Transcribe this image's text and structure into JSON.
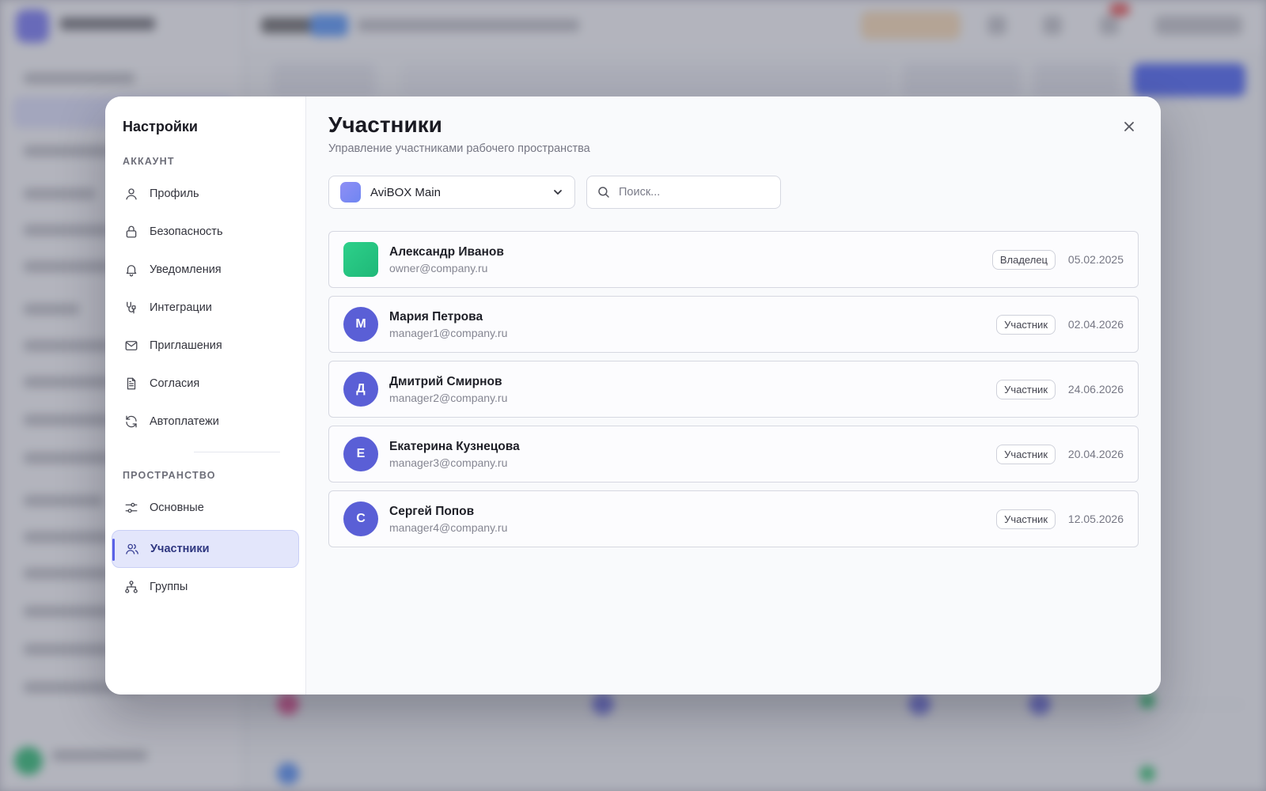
{
  "colors": {
    "accent": "#5a62e6",
    "accent_bg": "#e3e6fb",
    "owner_avatar": "#22c37f",
    "member_avatar": "#5a5fd6"
  },
  "settings_nav": {
    "title": "Настройки",
    "account_section": {
      "label": "АККАУНТ",
      "items": [
        {
          "label": "Профиль",
          "icon": "user-icon"
        },
        {
          "label": "Безопасность",
          "icon": "lock-icon"
        },
        {
          "label": "Уведомления",
          "icon": "bell-icon"
        },
        {
          "label": "Интеграции",
          "icon": "integration-icon"
        },
        {
          "label": "Приглашения",
          "icon": "mail-icon"
        },
        {
          "label": "Согласия",
          "icon": "document-icon"
        },
        {
          "label": "Автоплатежи",
          "icon": "refresh-icon"
        }
      ]
    },
    "space_section": {
      "label": "ПРОСТРАНСТВО",
      "items": [
        {
          "label": "Основные",
          "icon": "sliders-icon"
        },
        {
          "label": "Участники",
          "icon": "users-icon",
          "active": true
        },
        {
          "label": "Группы",
          "icon": "hierarchy-icon"
        }
      ]
    }
  },
  "main": {
    "title": "Участники",
    "subtitle": "Управление участниками рабочего пространства",
    "workspace_select": {
      "value": "AviBOX Main"
    },
    "search": {
      "placeholder": "Поиск...",
      "value": ""
    },
    "members": [
      {
        "initial": "",
        "name": "Александр Иванов",
        "email": "owner@company.ru",
        "role": "Владелец",
        "date": "05.02.2025"
      },
      {
        "initial": "М",
        "name": "Мария Петрова",
        "email": "manager1@company.ru",
        "role": "Участник",
        "date": "02.04.2026"
      },
      {
        "initial": "Д",
        "name": "Дмитрий Смирнов",
        "email": "manager2@company.ru",
        "role": "Участник",
        "date": "24.06.2026"
      },
      {
        "initial": "Е",
        "name": "Екатерина Кузнецова",
        "email": "manager3@company.ru",
        "role": "Участник",
        "date": "20.04.2026"
      },
      {
        "initial": "С",
        "name": "Сергей Попов",
        "email": "manager4@company.ru",
        "role": "Участник",
        "date": "12.05.2026"
      }
    ]
  }
}
